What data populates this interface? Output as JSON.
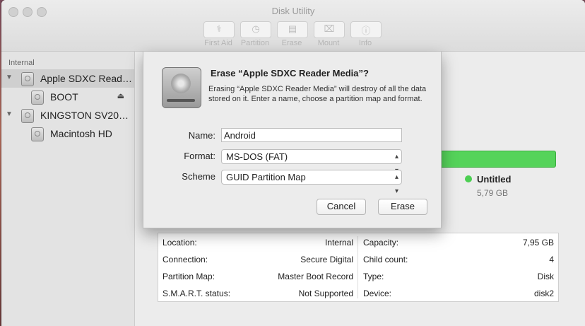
{
  "window": {
    "title": "Disk Utility"
  },
  "toolbar": [
    {
      "label": "First Aid",
      "icon": "stethoscope-icon"
    },
    {
      "label": "Partition",
      "icon": "partition-icon"
    },
    {
      "label": "Erase",
      "icon": "erase-icon"
    },
    {
      "label": "Mount",
      "icon": "mount-icon"
    },
    {
      "label": "Info",
      "icon": "info-icon"
    }
  ],
  "sidebar": {
    "section": "Internal",
    "items": [
      {
        "label": "Apple SDXC Read…",
        "selected": true
      },
      {
        "label": "BOOT"
      },
      {
        "label": "KINGSTON SV20…"
      },
      {
        "label": "Macintosh HD"
      }
    ]
  },
  "partition": {
    "name": "Untitled",
    "size": "5,79 GB",
    "color": "#55d35a"
  },
  "info": {
    "left": [
      {
        "k": "Location:",
        "v": "Internal"
      },
      {
        "k": "Connection:",
        "v": "Secure Digital"
      },
      {
        "k": "Partition Map:",
        "v": "Master Boot Record"
      },
      {
        "k": "S.M.A.R.T. status:",
        "v": "Not Supported"
      }
    ],
    "right": [
      {
        "k": "Capacity:",
        "v": "7,95 GB"
      },
      {
        "k": "Child count:",
        "v": "4"
      },
      {
        "k": "Type:",
        "v": "Disk"
      },
      {
        "k": "Device:",
        "v": "disk2"
      }
    ]
  },
  "dialog": {
    "title": "Erase “Apple SDXC Reader Media”?",
    "message": "Erasing “Apple SDXC Reader Media” will destroy of all the data stored on it. Enter a name, choose a partition map and format.",
    "name_label": "Name:",
    "name_value": "Android",
    "format_label": "Format:",
    "format_value": "MS-DOS (FAT)",
    "scheme_label": "Scheme",
    "scheme_value": "GUID Partition Map",
    "cancel": "Cancel",
    "erase": "Erase"
  }
}
